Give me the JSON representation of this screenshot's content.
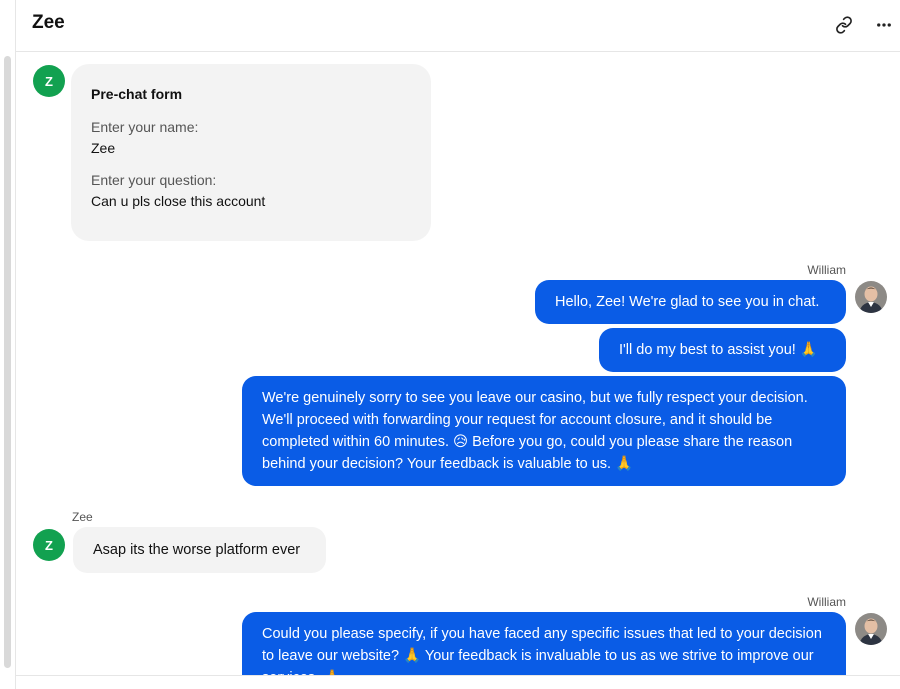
{
  "header": {
    "title": "Zee",
    "link_icon": "link-icon",
    "more_icon": "more-horizontal-icon"
  },
  "colors": {
    "agent_bubble": "#0a5ce6",
    "visitor_bubble": "#f3f3f3",
    "visitor_avatar": "#12a150"
  },
  "visitor": {
    "initial": "Z",
    "name": "Zee"
  },
  "agent": {
    "name": "William"
  },
  "prechat_form": {
    "title": "Pre-chat form",
    "name_label": "Enter your name:",
    "name_value": "Zee",
    "question_label": "Enter your question:",
    "question_value": "Can u pls close this account"
  },
  "messages": {
    "agent_1": "Hello, Zee! We're glad to see you in chat.",
    "agent_2": "I'll do my best to assist you! 🙏",
    "agent_3": "We're genuinely sorry to see you leave our casino, but we fully respect your decision. We'll proceed with forwarding your request for account closure, and it should be completed within 60 minutes. 😥 Before you go, could you please share the reason behind your decision? Your feedback is valuable to us. 🙏",
    "visitor_1": "Asap its the worse platform ever",
    "agent_4": "Could you please specify, if you have faced any specific issues that led to your decision to leave our website? 🙏 Your feedback is invaluable to us as we strive to improve our services. 🙏"
  }
}
